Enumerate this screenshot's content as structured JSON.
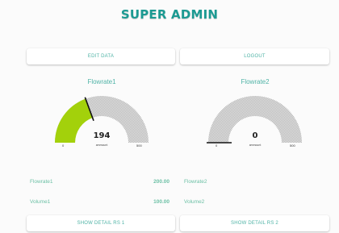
{
  "header": {
    "title": "SUPER ADMIN"
  },
  "toolbar": {
    "edit_label": "EDIT DATA",
    "logout_label": "LOGOUT"
  },
  "gauges": [
    {
      "title": "Flowrate1",
      "value": 194,
      "value_text": "194",
      "unit": "ammount",
      "min": 0,
      "max": 500,
      "min_text": "0",
      "max_text": "500",
      "fill_color": "#a3d10b",
      "track_color": "#cfcfcf"
    },
    {
      "title": "Flowrate2",
      "value": 0,
      "value_text": "0",
      "unit": "ammount",
      "min": 0,
      "max": 500,
      "min_text": "0",
      "max_text": "500",
      "fill_color": "#a3d10b",
      "track_color": "#cfcfcf"
    }
  ],
  "readings": {
    "flowrate1_label": "Flowrate1",
    "flowrate1_value": "200.00",
    "flowrate2_label": "Flowrate2",
    "volume1_label": "Volume1",
    "volume1_value": "100.00",
    "volume2_label": "Volume2"
  },
  "footer": {
    "detail1_label": "SHOW DETAIL RS 1",
    "detail2_label": "SHOW DETAIL RS 2"
  },
  "colors": {
    "accent": "#1c9a92",
    "text_green": "#6cc0a5",
    "button_text": "#4fb3a6"
  }
}
